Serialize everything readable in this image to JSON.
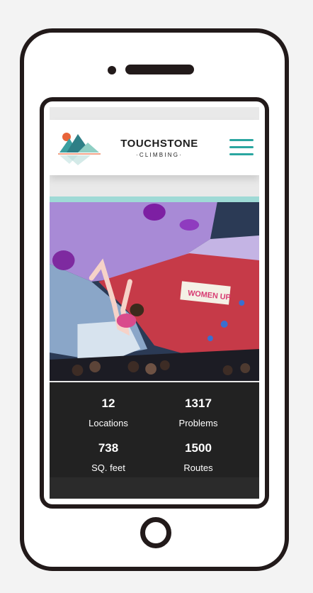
{
  "header": {
    "brand_name": "TOUCHSTONE",
    "brand_sub": "·CLIMBING·",
    "menu_icon": "hamburger-menu-icon",
    "accent_color": "#2aa6a0"
  },
  "hero": {
    "banner_text": "WOMEN UP"
  },
  "stats": [
    {
      "value": "12",
      "label": "Locations"
    },
    {
      "value": "1317",
      "label": "Problems"
    },
    {
      "value": "738",
      "label": "SQ. feet"
    },
    {
      "value": "1500",
      "label": "Routes"
    }
  ]
}
